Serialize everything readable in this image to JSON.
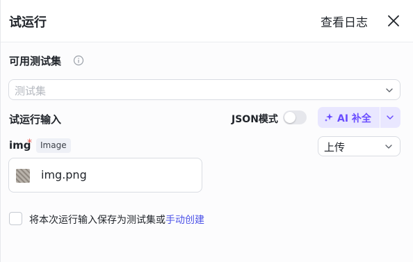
{
  "header": {
    "title": "试运行",
    "view_logs_label": "查看日志"
  },
  "test_sets": {
    "label": "可用测试集",
    "select_placeholder": "测试集"
  },
  "input": {
    "label": "试运行输入",
    "json_mode_label": "JSON模式",
    "json_mode_on": false,
    "ai_fill_label": "AI 补全"
  },
  "field": {
    "name": "img",
    "required_mark": "*",
    "type": "Image",
    "source_value": "上传",
    "file_name": "img.png"
  },
  "save": {
    "text": "将本次运行输入保存为测试集或",
    "link": "手动创建"
  },
  "colors": {
    "accent": "#4d53e8",
    "ai_text": "#6a4dff",
    "ai_bg": "#e9e7ff",
    "required": "#e5483d"
  },
  "icons": [
    "close-icon",
    "info-icon",
    "chevron-down-icon",
    "sparkle-icon",
    "image-thumbnail"
  ]
}
